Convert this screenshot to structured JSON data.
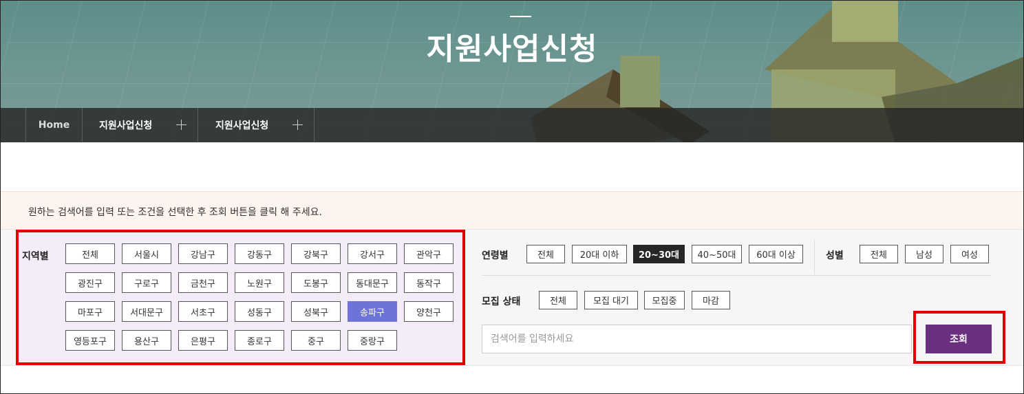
{
  "hero": {
    "title": "지원사업신청"
  },
  "breadcrumb": {
    "home": "Home",
    "level1": "지원사업신청",
    "level2": "지원사업신청"
  },
  "notice": "원하는 검색어를 입력 또는 조건을 선택한 후 조회 버튼을 클릭 해 주세요.",
  "region": {
    "label": "지역별",
    "selected": "송파구",
    "options": [
      "전체",
      "서울시",
      "강남구",
      "강동구",
      "강북구",
      "강서구",
      "관악구",
      "광진구",
      "구로구",
      "금천구",
      "노원구",
      "도봉구",
      "동대문구",
      "동작구",
      "마포구",
      "서대문구",
      "서초구",
      "성동구",
      "성북구",
      "송파구",
      "양천구",
      "영등포구",
      "용산구",
      "은평구",
      "종로구",
      "중구",
      "중랑구"
    ]
  },
  "age": {
    "label": "연령별",
    "selected": "20~30대",
    "options": [
      "전체",
      "20대 이하",
      "20~30대",
      "40~50대",
      "60대 이상"
    ]
  },
  "gender": {
    "label": "성별",
    "options": [
      "전체",
      "남성",
      "여성"
    ]
  },
  "status": {
    "label": "모집 상태",
    "options": [
      "전체",
      "모집 대기",
      "모집중",
      "마감"
    ]
  },
  "search": {
    "placeholder": "검색어를 입력하세요",
    "button": "조회"
  },
  "colors": {
    "selected_region": "#6d73d8",
    "search_button": "#6b2f7f",
    "highlight": "#e00000",
    "region_bg": "#f5ecf9"
  }
}
